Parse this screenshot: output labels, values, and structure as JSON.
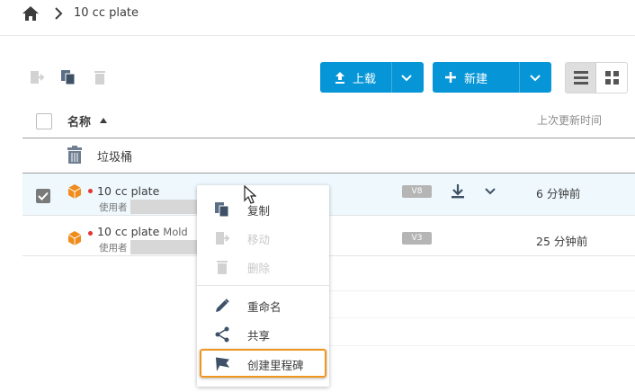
{
  "breadcrumb": {
    "current": "10 cc plate"
  },
  "toolbar": {
    "upload_label": "上载",
    "new_label": "新建"
  },
  "table": {
    "col_name": "名称",
    "col_updated": "上次更新时间",
    "recycle_bin": "垃圾桶",
    "rows": [
      {
        "name": "10 cc plate",
        "suffix": "",
        "owner_label": "使用者",
        "version": "V8",
        "updated": "6 分钟前",
        "selected": true
      },
      {
        "name": "10 cc plate",
        "suffix": "Mold",
        "owner_label": "使用者",
        "version": "V3",
        "updated": "25 分钟前",
        "selected": false
      }
    ]
  },
  "context_menu": {
    "copy": "复制",
    "move": "移动",
    "delete": "删除",
    "rename": "重命名",
    "share": "共享",
    "milestone": "创建里程碑"
  },
  "colors": {
    "accent": "#0696d7",
    "highlight": "#f0961e",
    "status_dot": "#e63333",
    "part_icon": "#f08c1e"
  }
}
